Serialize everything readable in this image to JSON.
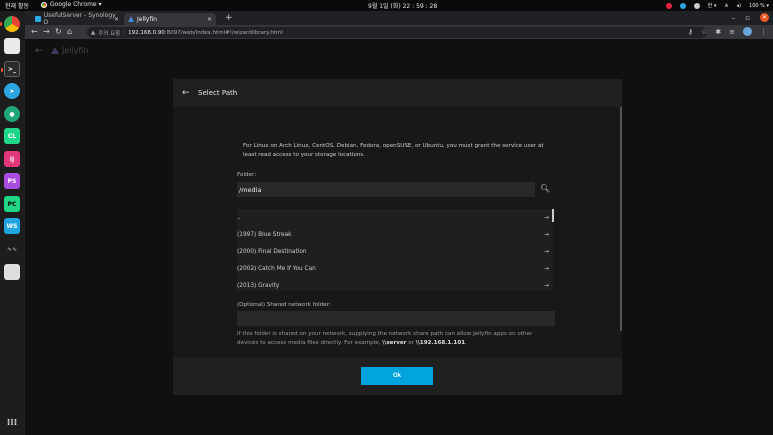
{
  "system": {
    "activities": "현재 활동",
    "app_name": "Google Chrome ▾",
    "clock": "9월 1일 (화)  22 : 59 : 28",
    "lang": "한 ▾",
    "battery": "100 % ▾"
  },
  "browser": {
    "tabs": [
      {
        "label": "UsefulServer - Synology D"
      },
      {
        "label": "Jellyfin"
      }
    ],
    "security_label": "주의 요함",
    "url_host": "192.168.0.90",
    "url_rest": ":8097/web/index.html#!/wizardlibrary.html"
  },
  "app": {
    "logo_text": "Jellyfin"
  },
  "dialog": {
    "title": "Select Path",
    "help_text": "For Linux on Arch Linux, CentOS, Debian, Fedora, openSUSE, or Ubuntu, you must grant the service user at least read access to your storage locations.",
    "folder_label": "Folder:",
    "folder_value": "/media",
    "directory_items": [
      {
        "label": ".."
      },
      {
        "label": "(1997) Blue Streak"
      },
      {
        "label": "(2000) Final Destination"
      },
      {
        "label": "(2002) Catch Me If You Can"
      },
      {
        "label": "(2013) Gravity"
      }
    ],
    "share_label": "(Optional) Shared network folder:",
    "share_value": "",
    "share_help_1": "If this folder is shared on your network, supplying the network share path can allow Jellyfin apps on other devices to access media files directly. For example, ",
    "share_example_1": "\\\\server",
    "share_help_or": " or ",
    "share_example_2": "\\\\192.168.1.101",
    "share_help_end": ".",
    "ok_label": "Ok"
  },
  "colors": {
    "accent": "#00a4dc",
    "ubuntu_orange": "#e95420"
  }
}
